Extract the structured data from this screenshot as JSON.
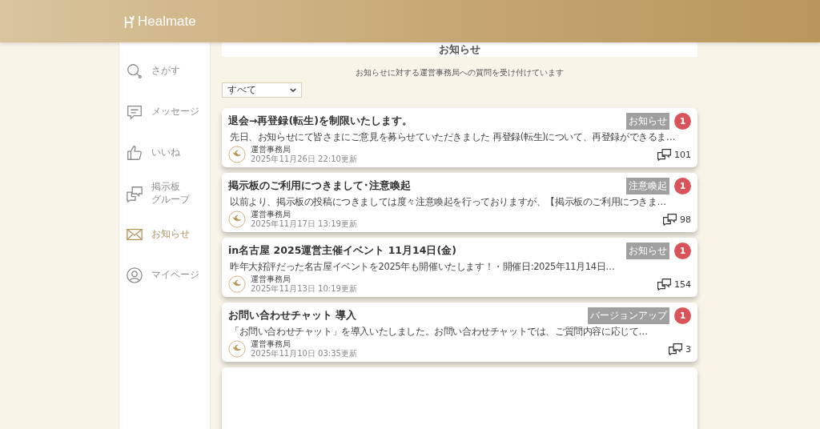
{
  "header": {
    "logo": "Healmate"
  },
  "sidebar": {
    "items": [
      {
        "kind": "search",
        "lines": [
          "さがす"
        ],
        "selected": false
      },
      {
        "kind": "message",
        "lines": [
          "メッセージ"
        ],
        "selected": false
      },
      {
        "kind": "like",
        "lines": [
          "いいね"
        ],
        "selected": false
      },
      {
        "kind": "board",
        "lines": [
          "掲示板",
          "グループ"
        ],
        "selected": false
      },
      {
        "kind": "mail",
        "lines": [
          "お知らせ"
        ],
        "selected": true
      },
      {
        "kind": "user",
        "lines": [
          "マイページ"
        ],
        "selected": false
      }
    ]
  },
  "page_title": "お知らせ",
  "notice": "お知らせに対する運営事務局への質問を受け付けています",
  "filter": {
    "value": "すべて"
  },
  "posts": [
    {
      "title": "退会→再登録(転生)を制限いたします。",
      "tag": "お知らせ",
      "badge": "1",
      "excerpt": "先日、お知らせにて皆さまにご意見を募らせていただきました 再登録(転生)について、再登録ができるま…",
      "author": "運営事務局",
      "date": "2025年11月26日 22:10更新",
      "comments": "101"
    },
    {
      "title": "掲示板のご利用につきまして･注意喚起",
      "tag": "注意喚起",
      "badge": "1",
      "excerpt": "以前より、掲示板の投稿につきましては度々注意喚起を行っておりますが、【掲示板のご利用につきま…",
      "author": "運営事務局",
      "date": "2025年11月17日 13:19更新",
      "comments": "98"
    },
    {
      "title": "in名古屋 2025運営主催イベント 11月14日(金)",
      "tag": "お知らせ",
      "badge": "1",
      "excerpt": "昨年大好評だった名古屋イベントを2025年も開催いたします！・開催日:2025年11月14日…",
      "author": "運営事務局",
      "date": "2025年11月13日 10:19更新",
      "comments": "154"
    },
    {
      "title": "お問い合わせチャット 導入",
      "tag": "バージョンアップ",
      "badge": "1",
      "excerpt": "「お問い合わせチャット」を導入いたしました。お問い合わせチャットでは、ご質問内容に応じて…",
      "author": "運営事務局",
      "date": "2025年11月10日 03:35更新",
      "comments": "3"
    }
  ]
}
